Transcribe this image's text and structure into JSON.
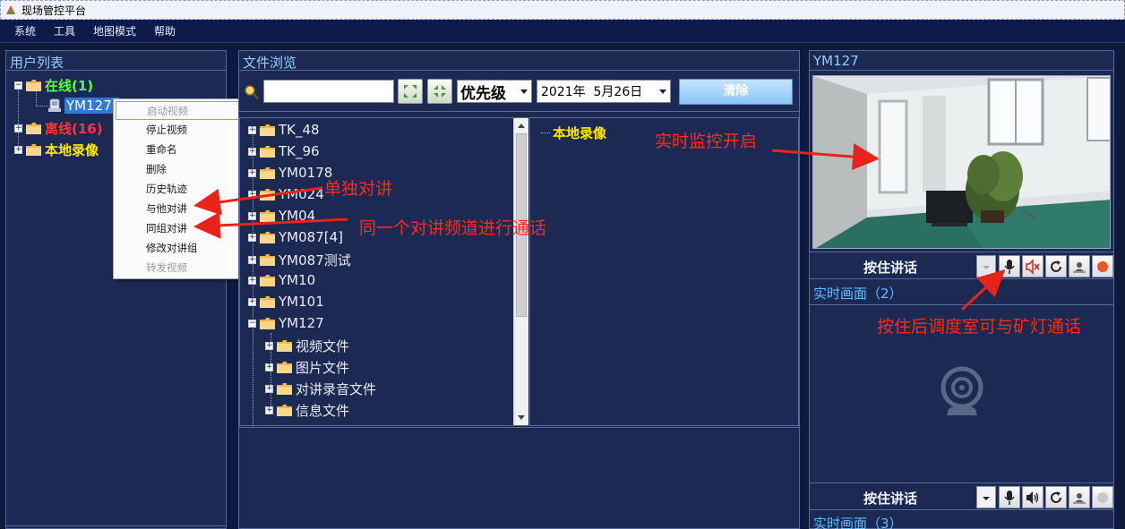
{
  "window": {
    "title": "现场管控平台"
  },
  "menu": [
    "系统",
    "工具",
    "地图模式",
    "帮助"
  ],
  "user_panel": {
    "title": "用户列表",
    "groups": [
      {
        "label": "在线(1)",
        "color": "#5dff3a"
      },
      {
        "label": "离线(16)",
        "color": "#ff3434"
      },
      {
        "label": "本地录像",
        "color": "#ffea00"
      }
    ],
    "selected_user": "YM127("
  },
  "context_menu": {
    "items": [
      {
        "label": "启动视频",
        "disabled": true
      },
      {
        "label": "停止视频",
        "disabled": false
      },
      {
        "label": "重命名",
        "disabled": false
      },
      {
        "label": "删除",
        "disabled": false
      },
      {
        "label": "历史轨迹",
        "disabled": false
      },
      {
        "label": "与他对讲",
        "disabled": false
      },
      {
        "label": "同组对讲",
        "disabled": false
      },
      {
        "label": "修改对讲组",
        "disabled": false
      },
      {
        "label": "转发视频",
        "disabled": true
      }
    ]
  },
  "file_panel": {
    "title": "文件浏览",
    "search_value": "",
    "priority_select": "优先级",
    "date_select": "2021年  5月26日",
    "clear_button": "清除",
    "tree": [
      "TK_48",
      "TK_96",
      "YM0178",
      "YM024",
      "YM04",
      "YM087[4]",
      "YM087测试",
      "YM10",
      "YM101",
      "YM127"
    ],
    "children": [
      "视频文件",
      "图片文件",
      "对讲录音文件",
      "信息文件"
    ],
    "right_label": "本地录像"
  },
  "video_panel": {
    "title": "YM127",
    "ptt_label_1": "按住讲话",
    "ptt_label_2": "按住讲话",
    "screen_2": "实时画面（2）",
    "screen_3": "实时画面（3）"
  },
  "annotations": {
    "individual_talk": "单独对讲",
    "group_talk": "同一个对讲频道进行通话",
    "monitor_on": "实时监控开启",
    "press_talk": "按住后调度室可与矿灯通话"
  }
}
